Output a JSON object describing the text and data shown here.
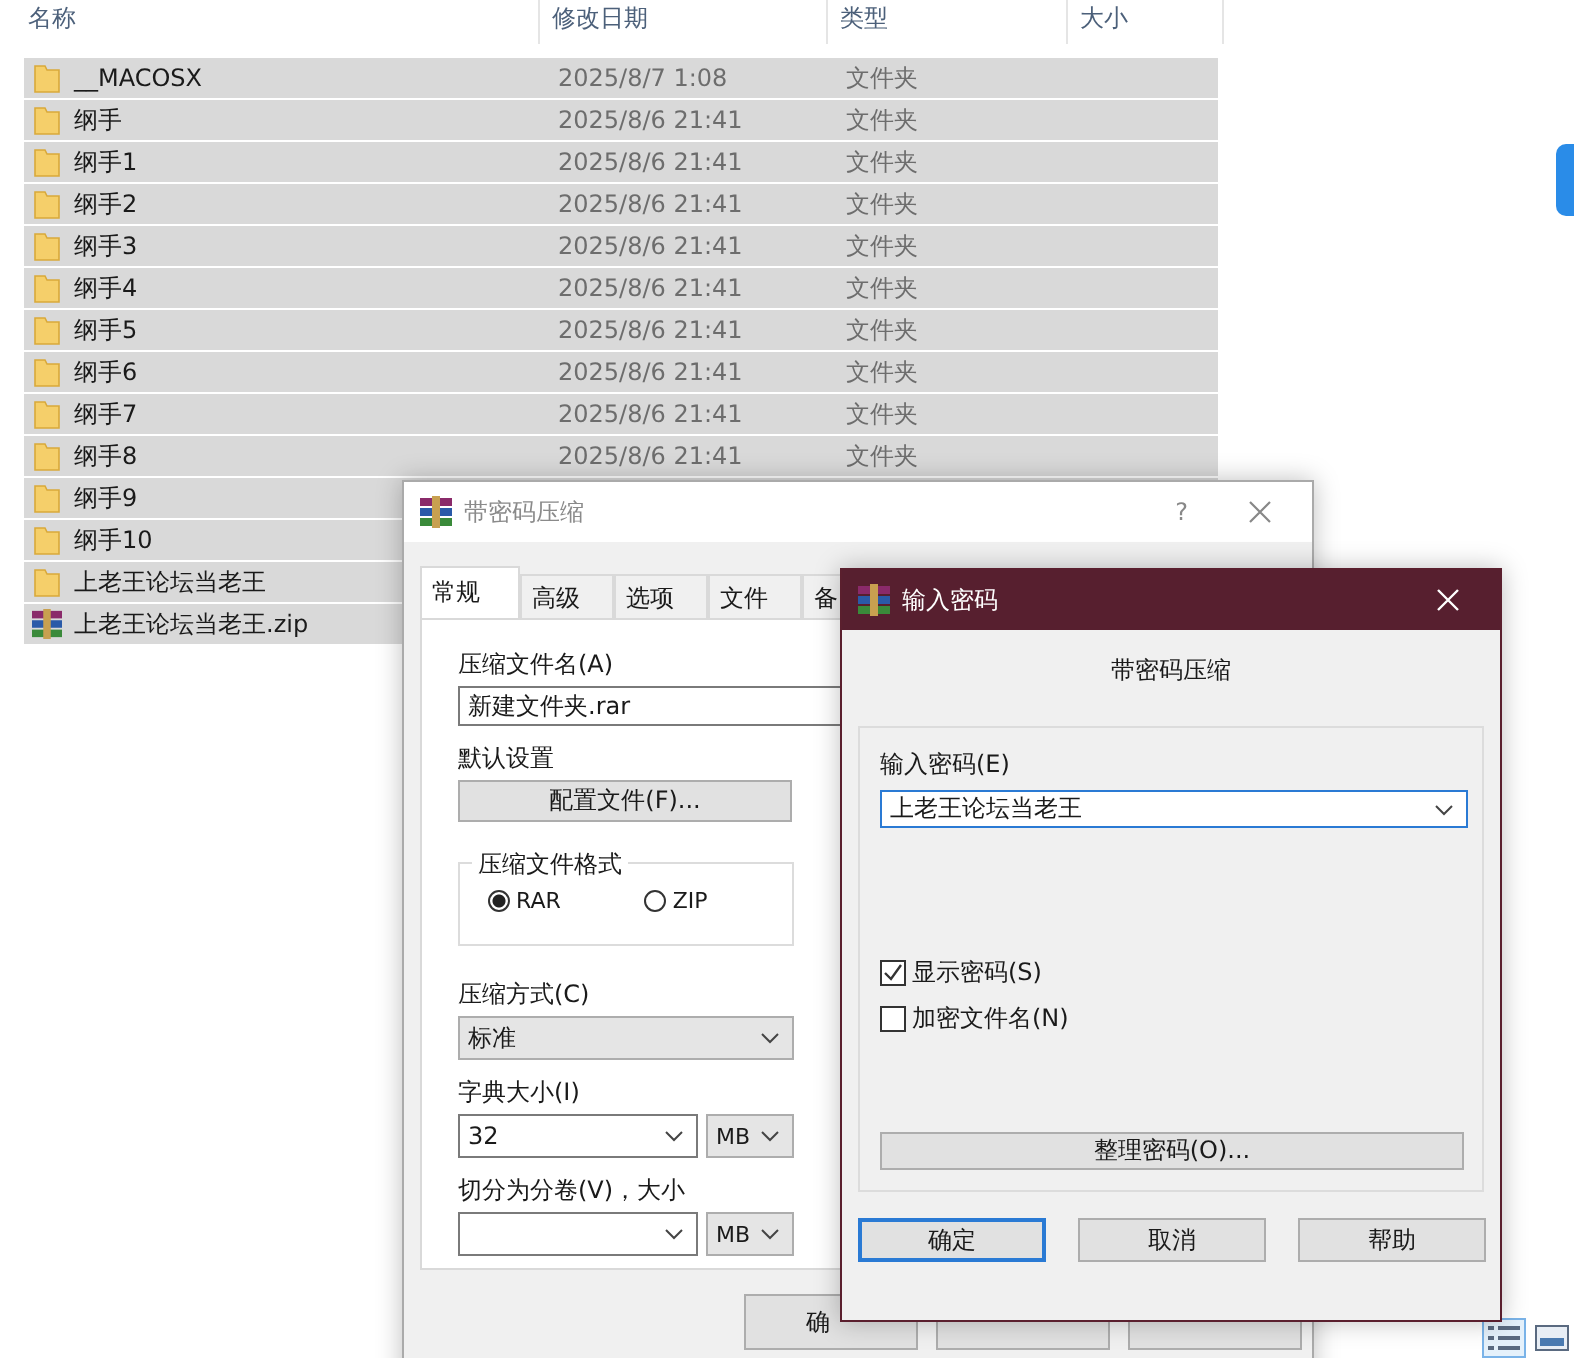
{
  "explorer": {
    "columns": [
      "名称",
      "修改日期",
      "类型",
      "大小"
    ],
    "rows": [
      {
        "kind": "folder",
        "name": "__MACOSX",
        "date": "2025/8/7 1:08",
        "type": "文件夹",
        "selected": true
      },
      {
        "kind": "folder",
        "name": "纲手",
        "date": "2025/8/6 21:41",
        "type": "文件夹",
        "selected": true
      },
      {
        "kind": "folder",
        "name": "纲手1",
        "date": "2025/8/6 21:41",
        "type": "文件夹",
        "selected": true
      },
      {
        "kind": "folder",
        "name": "纲手2",
        "date": "2025/8/6 21:41",
        "type": "文件夹",
        "selected": true
      },
      {
        "kind": "folder",
        "name": "纲手3",
        "date": "2025/8/6 21:41",
        "type": "文件夹",
        "selected": true
      },
      {
        "kind": "folder",
        "name": "纲手4",
        "date": "2025/8/6 21:41",
        "type": "文件夹",
        "selected": true
      },
      {
        "kind": "folder",
        "name": "纲手5",
        "date": "2025/8/6 21:41",
        "type": "文件夹",
        "selected": true
      },
      {
        "kind": "folder",
        "name": "纲手6",
        "date": "2025/8/6 21:41",
        "type": "文件夹",
        "selected": true
      },
      {
        "kind": "folder",
        "name": "纲手7",
        "date": "2025/8/6 21:41",
        "type": "文件夹",
        "selected": true
      },
      {
        "kind": "folder",
        "name": "纲手8",
        "date": "2025/8/6 21:41",
        "type": "文件夹",
        "selected": true
      },
      {
        "kind": "folder",
        "name": "纲手9",
        "selected": true
      },
      {
        "kind": "folder",
        "name": "纲手10",
        "selected": true
      },
      {
        "kind": "folder",
        "name": "上老王论坛当老王",
        "selected": true
      },
      {
        "kind": "archive",
        "name": "上老王论坛当老王.zip",
        "selected": true
      }
    ],
    "view_modes": [
      {
        "kind": "details",
        "selected": true
      },
      {
        "kind": "large",
        "selected": false
      }
    ]
  },
  "compress_dialog": {
    "title": "带密码压缩",
    "help": "?",
    "tabs": [
      {
        "label": "常规",
        "selected": true
      },
      {
        "label": "高级",
        "selected": false
      },
      {
        "label": "选项",
        "selected": false
      },
      {
        "label": "文件",
        "selected": false
      },
      {
        "label": "备",
        "selected": false
      }
    ],
    "archive_name_label": "压缩文件名(A)",
    "archive_name": "新建文件夹.rar",
    "defaults_label": "默认设置",
    "profiles_button": "配置文件(F)...",
    "format_group": "压缩文件格式",
    "formats": [
      {
        "label": "RAR",
        "selected": true
      },
      {
        "label": "ZIP",
        "selected": false
      }
    ],
    "method_label": "压缩方式(C)",
    "method": "标准",
    "dictionary_label": "字典大小(I)",
    "dictionary": "32",
    "dictionary_unit": "MB",
    "volume_label": "切分为分卷(V)，大小",
    "volume_unit": "MB",
    "ok_button": "确"
  },
  "password_dialog": {
    "title": "输入密码",
    "heading": "带密码压缩",
    "password_label": "输入密码(E)",
    "password": "上老王论坛当老王",
    "options": [
      {
        "label": "显示密码(S)",
        "checked": true
      },
      {
        "label": "加密文件名(N)",
        "checked": false
      }
    ],
    "manage_button": "整理密码(O)...",
    "buttons": [
      {
        "label": "确定",
        "default": true
      },
      {
        "label": "取消",
        "default": false
      },
      {
        "label": "帮助",
        "default": false
      }
    ]
  }
}
